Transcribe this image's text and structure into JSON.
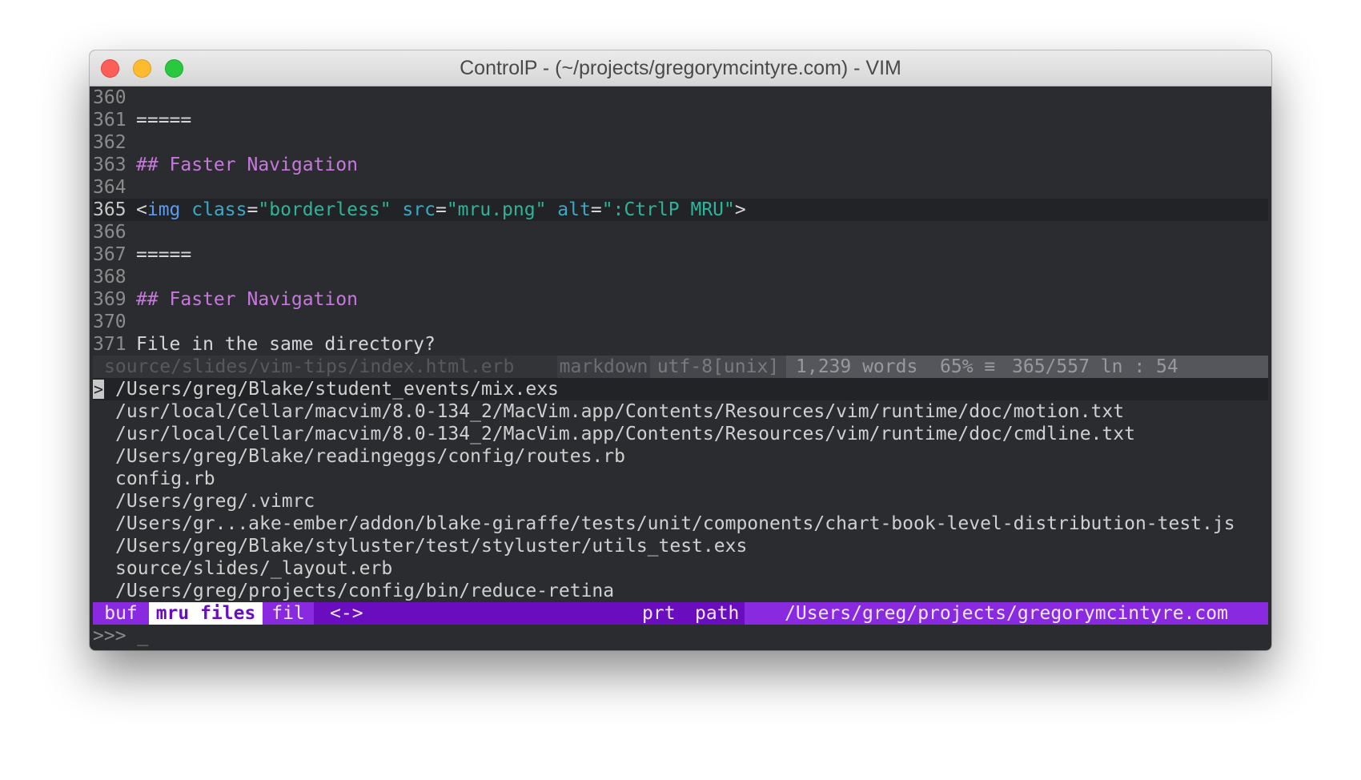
{
  "window": {
    "title": "ControlP - (~/projects/gregorymcintyre.com) - VIM"
  },
  "editor": {
    "lines": [
      {
        "num": "360",
        "tokens": []
      },
      {
        "num": "361",
        "tokens": [
          {
            "cls": "tk-white",
            "text": "====="
          }
        ]
      },
      {
        "num": "362",
        "tokens": []
      },
      {
        "num": "363",
        "tokens": [
          {
            "cls": "tk-purple",
            "text": "## Faster Navigation"
          }
        ]
      },
      {
        "num": "364",
        "tokens": []
      },
      {
        "num": "365",
        "current": true,
        "tokens": [
          {
            "cls": "tk-white",
            "text": "<"
          },
          {
            "cls": "tk-tag",
            "text": "img"
          },
          {
            "cls": "tk-white",
            "text": " "
          },
          {
            "cls": "tk-cyan",
            "text": "class"
          },
          {
            "cls": "tk-white",
            "text": "="
          },
          {
            "cls": "tk-green",
            "text": "\"borderless\""
          },
          {
            "cls": "tk-white",
            "text": " "
          },
          {
            "cls": "tk-cyan",
            "text": "src"
          },
          {
            "cls": "tk-white",
            "text": "="
          },
          {
            "cls": "tk-green",
            "text": "\"mru.png\""
          },
          {
            "cls": "tk-white",
            "text": " "
          },
          {
            "cls": "tk-cyan",
            "text": "alt"
          },
          {
            "cls": "tk-white",
            "text": "="
          },
          {
            "cls": "tk-green",
            "text": "\":CtrlP MRU\""
          },
          {
            "cls": "tk-white",
            "text": ">"
          }
        ]
      },
      {
        "num": "366",
        "tokens": []
      },
      {
        "num": "367",
        "tokens": [
          {
            "cls": "tk-white",
            "text": "====="
          }
        ]
      },
      {
        "num": "368",
        "tokens": []
      },
      {
        "num": "369",
        "tokens": [
          {
            "cls": "tk-purple",
            "text": "## Faster Navigation"
          }
        ]
      },
      {
        "num": "370",
        "tokens": []
      },
      {
        "num": "371",
        "tokens": [
          {
            "cls": "tk-white",
            "text": "File in the same directory?"
          }
        ]
      }
    ]
  },
  "statusline": {
    "file": "source/slides/vim-tips/index.html.erb",
    "filetype": "markdown",
    "encoding": "utf-8[unix]",
    "words": "1,239 words",
    "percent": "65% ≡",
    "position": "365/557 ln : 54"
  },
  "ctrlp": {
    "selected_marker": ">",
    "matches": [
      "/Users/greg/Blake/student_events/mix.exs",
      "/usr/local/Cellar/macvim/8.0-134_2/MacVim.app/Contents/Resources/vim/runtime/doc/motion.txt",
      "/usr/local/Cellar/macvim/8.0-134_2/MacVim.app/Contents/Resources/vim/runtime/doc/cmdline.txt",
      "/Users/greg/Blake/readingeggs/config/routes.rb",
      "config.rb",
      "/Users/greg/.vimrc",
      "/Users/gr...ake-ember/addon/blake-giraffe/tests/unit/components/chart-book-level-distribution-test.js",
      "/Users/greg/Blake/styluster/test/styluster/utils_test.exs",
      "source/slides/_layout.erb",
      "/Users/greg/projects/config/bin/reduce-retina"
    ],
    "modes": {
      "buf": "buf",
      "mru": "mru files",
      "fil": "fil",
      "arrow": "<->"
    },
    "prt": "prt",
    "path_label": "path",
    "working_dir": "/Users/greg/projects/gregorymcintyre.com",
    "prompt": ">>> _"
  }
}
